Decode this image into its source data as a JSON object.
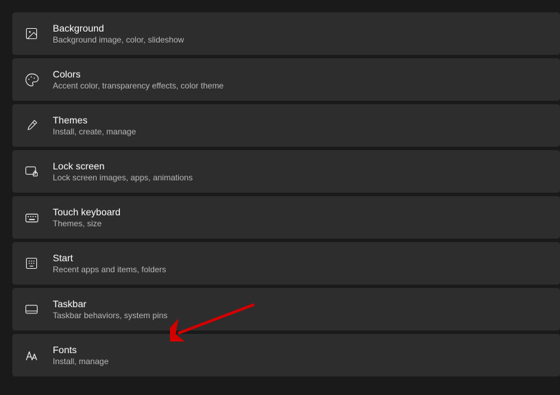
{
  "items": [
    {
      "title": "Background",
      "desc": "Background image, color, slideshow"
    },
    {
      "title": "Colors",
      "desc": "Accent color, transparency effects, color theme"
    },
    {
      "title": "Themes",
      "desc": "Install, create, manage"
    },
    {
      "title": "Lock screen",
      "desc": "Lock screen images, apps, animations"
    },
    {
      "title": "Touch keyboard",
      "desc": "Themes, size"
    },
    {
      "title": "Start",
      "desc": "Recent apps and items, folders"
    },
    {
      "title": "Taskbar",
      "desc": "Taskbar behaviors, system pins"
    },
    {
      "title": "Fonts",
      "desc": "Install, manage"
    }
  ]
}
